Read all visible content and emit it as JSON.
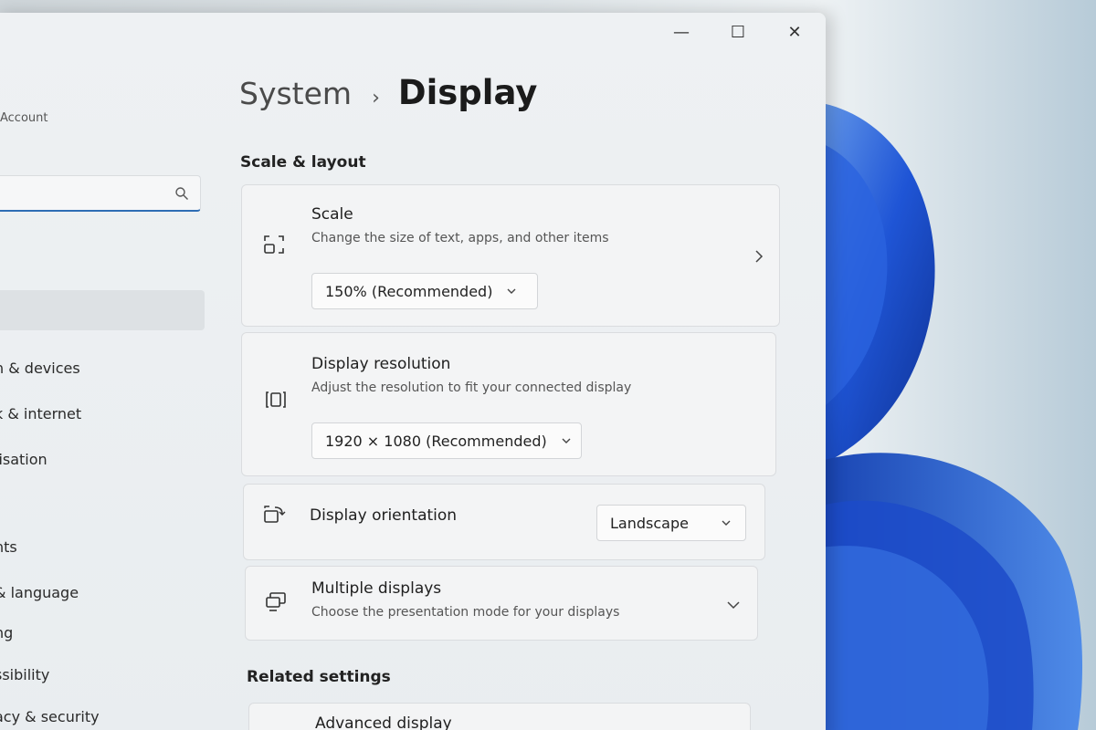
{
  "window": {
    "controls": {
      "minimize": "—",
      "maximize": "☐",
      "close": "✕"
    }
  },
  "sidebar": {
    "account_label": "Account",
    "search": {
      "value": "",
      "placeholder": ""
    },
    "items": [
      {
        "label": "h & devices"
      },
      {
        "label": "k & internet"
      },
      {
        "label": "lisation"
      },
      {
        "label": "nts"
      },
      {
        "label": "& language"
      },
      {
        "label": "ng"
      },
      {
        "label": "ssibility"
      },
      {
        "label": "acy & security"
      }
    ]
  },
  "main": {
    "breadcrumb": {
      "parent": "System",
      "separator": "›",
      "current": "Display"
    },
    "section_scale_layout": "Scale & layout",
    "scale": {
      "title": "Scale",
      "description": "Change the size of text, apps, and other items",
      "value": "150% (Recommended)"
    },
    "resolution": {
      "title": "Display resolution",
      "description": "Adjust the resolution to fit your connected display",
      "value": "1920 × 1080 (Recommended)"
    },
    "orientation": {
      "title": "Display orientation",
      "value": "Landscape"
    },
    "multiple": {
      "title": "Multiple displays",
      "description": "Choose the presentation mode for your displays"
    },
    "section_related": "Related settings",
    "advanced": {
      "title": "Advanced display"
    }
  },
  "colors": {
    "accent": "#2e6db4",
    "wallpaper_blue": "#1a4fd0"
  }
}
